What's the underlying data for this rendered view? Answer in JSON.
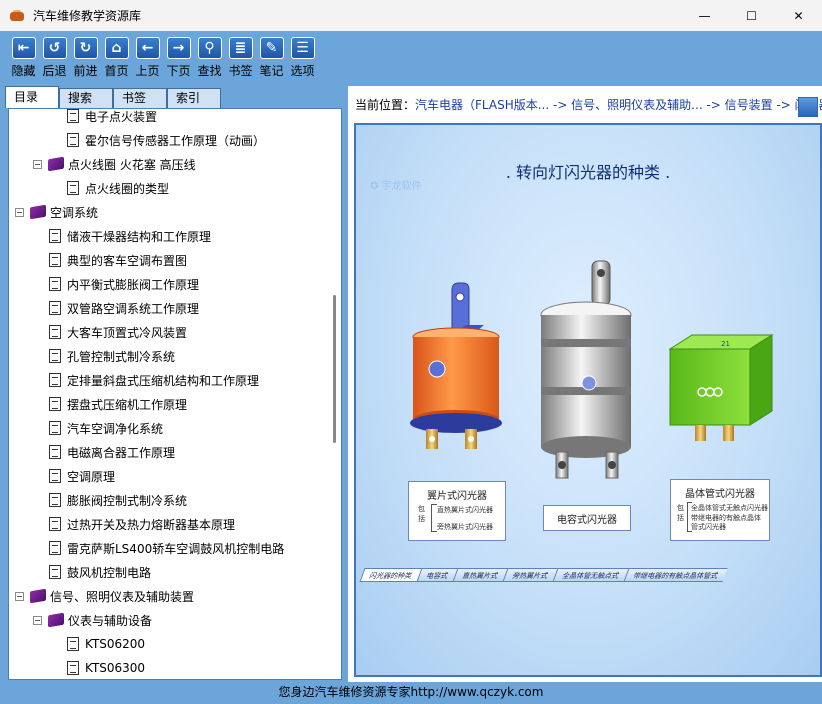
{
  "window": {
    "title": "汽车维修教学资源库",
    "minimize": "—",
    "maximize": "☐",
    "close": "✕"
  },
  "toolbar": [
    {
      "label": "隐藏",
      "glyph": "⇤",
      "icon": "hide-icon"
    },
    {
      "label": "后退",
      "glyph": "↺",
      "icon": "back-icon"
    },
    {
      "label": "前进",
      "glyph": "↻",
      "icon": "forward-icon"
    },
    {
      "label": "首页",
      "glyph": "⌂",
      "icon": "home-icon"
    },
    {
      "label": "上页",
      "glyph": "←",
      "icon": "prev-page-icon"
    },
    {
      "label": "下页",
      "glyph": "→",
      "icon": "next-page-icon"
    },
    {
      "label": "查找",
      "glyph": "⚲",
      "icon": "search-icon"
    },
    {
      "label": "书签",
      "glyph": "≣",
      "icon": "bookmark-icon"
    },
    {
      "label": "笔记",
      "glyph": "✎",
      "icon": "note-icon"
    },
    {
      "label": "选项",
      "glyph": "☰",
      "icon": "options-icon"
    }
  ],
  "tabs": [
    "目录",
    "搜索",
    "书签",
    "索引"
  ],
  "tree": [
    {
      "label": "电子点火装置",
      "level": 3,
      "type": "page"
    },
    {
      "label": "霍尔信号传感器工作原理（动画）",
      "level": 3,
      "type": "page"
    },
    {
      "label": "点火线圈 火花塞 高压线",
      "level": 2,
      "type": "book",
      "expander": "⊟"
    },
    {
      "label": "点火线圈的类型",
      "level": 3,
      "type": "page"
    },
    {
      "label": "空调系统",
      "level": 1,
      "type": "book",
      "expander": "⊟"
    },
    {
      "label": "储液干燥器结构和工作原理",
      "level": 2,
      "type": "page"
    },
    {
      "label": "典型的客车空调布置图",
      "level": 2,
      "type": "page"
    },
    {
      "label": "内平衡式膨胀阀工作原理",
      "level": 2,
      "type": "page"
    },
    {
      "label": "双管路空调系统工作原理",
      "level": 2,
      "type": "page"
    },
    {
      "label": "大客车顶置式冷风装置",
      "level": 2,
      "type": "page"
    },
    {
      "label": "孔管控制式制冷系统",
      "level": 2,
      "type": "page"
    },
    {
      "label": "定排量斜盘式压缩机结构和工作原理",
      "level": 2,
      "type": "page"
    },
    {
      "label": "摆盘式压缩机工作原理",
      "level": 2,
      "type": "page"
    },
    {
      "label": "汽车空调净化系统",
      "level": 2,
      "type": "page"
    },
    {
      "label": "电磁离合器工作原理",
      "level": 2,
      "type": "page"
    },
    {
      "label": "空调原理",
      "level": 2,
      "type": "page"
    },
    {
      "label": "膨胀阀控制式制冷系统",
      "level": 2,
      "type": "page"
    },
    {
      "label": "过热开关及热力熔断器基本原理",
      "level": 2,
      "type": "page"
    },
    {
      "label": "雷克萨斯LS400轿车空调鼓风机控制电路",
      "level": 2,
      "type": "page"
    },
    {
      "label": "鼓风机控制电路",
      "level": 2,
      "type": "page"
    },
    {
      "label": "信号、照明仪表及辅助装置",
      "level": 1,
      "type": "book",
      "expander": "⊟"
    },
    {
      "label": "仪表与辅助设备",
      "level": 2,
      "type": "book",
      "expander": "⊟"
    },
    {
      "label": "KTS06200",
      "level": 3,
      "type": "page"
    },
    {
      "label": "KTS06300",
      "level": 3,
      "type": "page"
    }
  ],
  "location": {
    "label": "当前位置：",
    "path": "汽车电器（FLASH版本... -> 信号、照明仪表及辅助... -> 信号装置 -> 闪光器"
  },
  "flash": {
    "title": ". 转向灯闪光器的种类 .",
    "watermark": "宇龙软件",
    "captions": {
      "vane": {
        "title": "翼片式闪光器",
        "side": "包括",
        "items": [
          "直热翼片式闪光器",
          "旁热翼片式闪光器"
        ]
      },
      "capacitor": {
        "title": "电容式闪光器"
      },
      "transistor": {
        "title": "晶体管式闪光器",
        "side": "包括",
        "items": [
          "全晶体管式无触点闪光器",
          "带继电器的有触点晶体管式闪光器"
        ]
      }
    },
    "relay_label": "21",
    "bottom_tabs": [
      "闪光器的种类",
      "电容式",
      "直热翼片式",
      "旁热翼片式",
      "全晶体管无触点式",
      "带继电器的有触点晶体管式"
    ]
  },
  "status": "您身边汽车维修资源专家http://www.qczyk.com"
}
